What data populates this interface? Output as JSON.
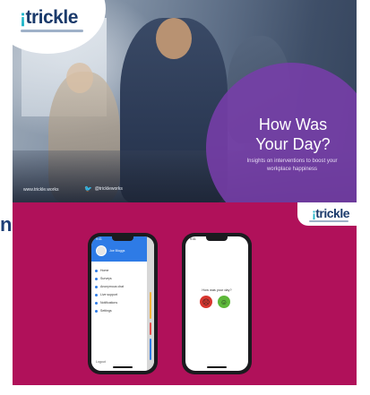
{
  "top_card": {
    "logo_text_bar": "¡",
    "logo_text": "trickle",
    "headline_line1": "How Was",
    "headline_line2": "Your Day?",
    "subline": "Insights on interventions to boost your workplace happiness",
    "website": "www.trickle.works",
    "social_handle": "@trickleworks",
    "social_icon": "twitter-icon"
  },
  "bottom_card": {
    "logo_text_bar": "¡",
    "logo_text": "trickle",
    "edge_letter": "n",
    "background_color": "#b0115a"
  },
  "phone_left": {
    "time": "9:41",
    "user_name": "Joe Bloggs",
    "menu_items": [
      "Home",
      "Surveys",
      "Anonymous chat",
      "Live support",
      "Notifications",
      "Settings"
    ],
    "footer": "Logout",
    "accent_color": "#2e7be6"
  },
  "phone_right": {
    "time": "9:41",
    "question": "How was your day?",
    "mood_sad_icon": "sad-face-icon",
    "mood_happy_icon": "happy-face-icon",
    "mood_sad_glyph": "☹",
    "mood_happy_glyph": "☺"
  }
}
